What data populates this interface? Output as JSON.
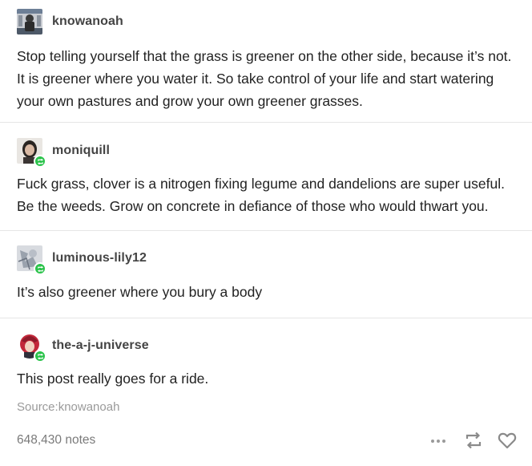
{
  "reblogs": [
    {
      "username": "knowanoah",
      "avatar_icon": "user-avatar-icon",
      "text": "Stop telling yourself that the grass is greener on the other side, because it’s not. It is greener where you water it. So take control of your life and start watering your own pastures and grow your own greener grasses."
    },
    {
      "username": "moniquill",
      "avatar_icon": "user-avatar-icon",
      "text": "Fuck grass, clover is a nitrogen fixing legume and dandelions are super useful. Be the weeds. Grow on concrete in defiance of those who would thwart you."
    },
    {
      "username": "luminous-lily12",
      "avatar_icon": "user-avatar-icon",
      "text": "It’s also greener where you bury a body"
    },
    {
      "username": "the-a-j-universe",
      "avatar_icon": "user-avatar-icon",
      "text": "This post really goes for a ride."
    }
  ],
  "source": "Source:knowanoah",
  "notes": "648,430 notes",
  "icons": {
    "reblog_badge": "reblog-badge-icon",
    "more": "more-options-icon",
    "reblog": "reblog-icon",
    "like": "heart-icon"
  },
  "colors": {
    "reblog_green": "#2bc34b",
    "muted_text": "#9a9a9a",
    "divider": "#e6e6e6"
  }
}
